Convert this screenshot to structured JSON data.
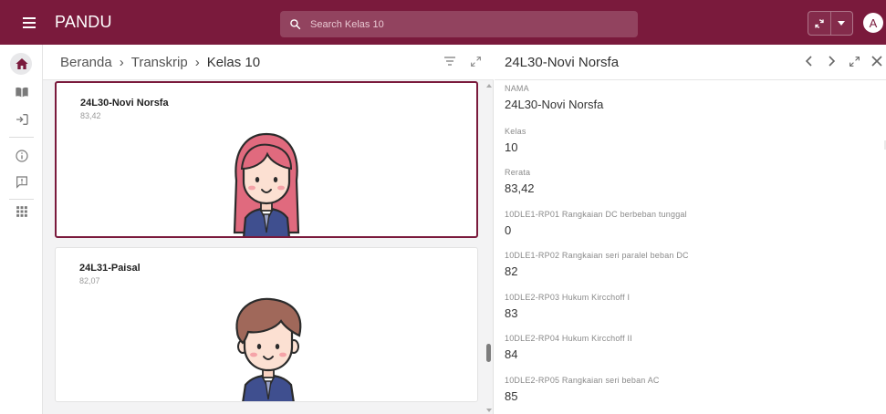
{
  "app": {
    "title": "PANDU"
  },
  "search": {
    "placeholder": "Search Kelas 10"
  },
  "user": {
    "avatar_letter": "A"
  },
  "nav": {
    "items": [
      {
        "name": "home-icon",
        "active": true
      },
      {
        "name": "book-icon",
        "active": false
      },
      {
        "name": "login-icon",
        "active": false
      },
      {
        "name": "info-icon",
        "active": false
      },
      {
        "name": "feedback-icon",
        "active": false
      },
      {
        "name": "apps-grid-icon",
        "active": false
      }
    ]
  },
  "breadcrumb": {
    "items": [
      "Beranda",
      "Transkrip",
      "Kelas 10"
    ],
    "separator": "›"
  },
  "cards": [
    {
      "name": "24L30-Novi Norsfa",
      "score": "83,42",
      "avatar": "girl",
      "selected": true
    },
    {
      "name": "24L31-Paisal",
      "score": "82,07",
      "avatar": "boy",
      "selected": false
    }
  ],
  "detail": {
    "title": "24L30-Novi Norsfa",
    "fields": [
      {
        "label": "NAMA",
        "value": "24L30-Novi Norsfa"
      },
      {
        "label": "Kelas",
        "value": "10"
      },
      {
        "label": "Rerata",
        "value": "83,42"
      },
      {
        "label": "10DLE1-RP01 Rangkaian DC berbeban tunggal",
        "value": "0"
      },
      {
        "label": "10DLE1-RP02 Rangkaian seri paralel beban DC",
        "value": "82"
      },
      {
        "label": "10DLE2-RP03 Hukum Kircchoff I",
        "value": "83"
      },
      {
        "label": "10DLE2-RP04 Hukum Kircchoff II",
        "value": "84"
      },
      {
        "label": "10DLE2-RP05 Rangkaian seri beban AC",
        "value": "85"
      }
    ]
  },
  "colors": {
    "brand": "#7a1a3c",
    "panel_bg": "#f3f3f4"
  }
}
